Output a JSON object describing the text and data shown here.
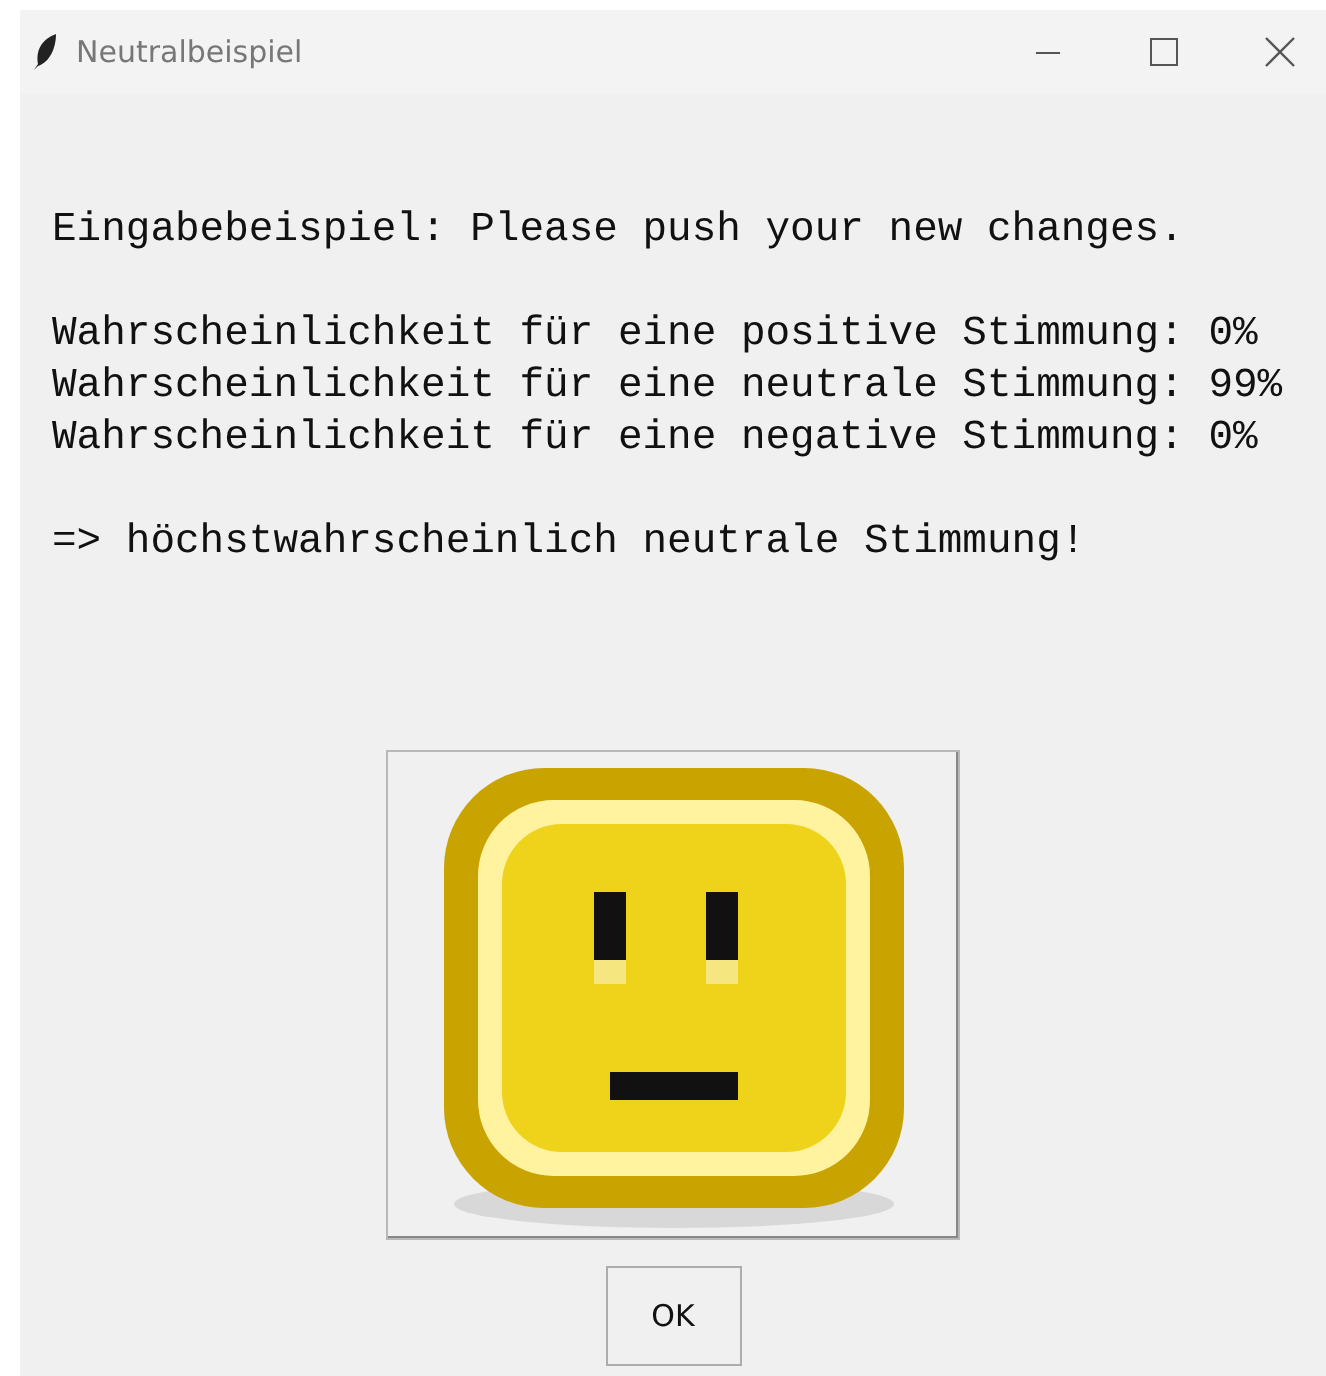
{
  "window": {
    "title": "Neutralbeispiel"
  },
  "intro": "Eingabebeispiel: Please push your new changes.",
  "probabilities": [
    "Wahrscheinlichkeit für eine positive Stimmung: 0%",
    "Wahrscheinlichkeit für eine neutrale Stimmung: 99%",
    "Wahrscheinlichkeit für eine negative Stimmung: 0%"
  ],
  "conclusion": "=> höchstwahrscheinlich neutrale Stimmung!",
  "ok_button": {
    "label": "OK"
  }
}
